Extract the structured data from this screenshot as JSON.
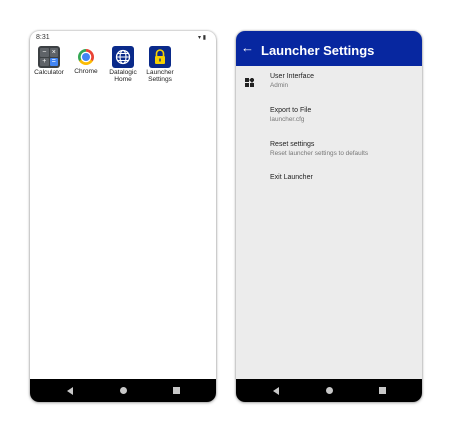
{
  "left_phone": {
    "status": {
      "time": "8:31",
      "icons": "▾ ▮"
    },
    "apps": [
      {
        "label": "Calculator",
        "icon": "calculator-icon"
      },
      {
        "label": "Chrome",
        "icon": "chrome-icon"
      },
      {
        "label": "Datalogic\nHome",
        "icon": "globe-icon"
      },
      {
        "label": "Launcher\nSettings",
        "icon": "lock-icon"
      }
    ],
    "calc_keys": [
      "−",
      "×",
      "+",
      "="
    ]
  },
  "right_phone": {
    "title": "Launcher Settings",
    "back_glyph": "←",
    "settings": [
      {
        "title": "User Interface",
        "subtitle": "Admin"
      },
      {
        "title": "Export to File",
        "subtitle": "launcher.cfg"
      },
      {
        "title": "Reset settings",
        "subtitle": "Reset launcher settings to defaults"
      },
      {
        "title": "Exit Launcher",
        "subtitle": ""
      }
    ]
  },
  "colors": {
    "appbar": "#0727a0",
    "navbar": "#000000",
    "settings_bg": "#ececec",
    "icon_blue": "#0a2a8a"
  }
}
